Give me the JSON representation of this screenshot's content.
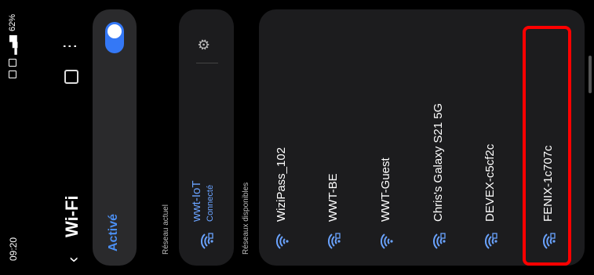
{
  "status": {
    "time": "09:20",
    "battery": "62%"
  },
  "header": {
    "back_icon": "chevron-left-icon",
    "title": "Wi-Fi"
  },
  "toggle": {
    "label": "Activé",
    "on": true,
    "accent": "#3478f6"
  },
  "current": {
    "section_label": "Réseau actuel",
    "network": {
      "ssid": "wwt-IoT",
      "status": "Connecté"
    }
  },
  "available": {
    "section_label": "Réseaux disponibles",
    "networks": [
      {
        "ssid": "WiziPass_102"
      },
      {
        "ssid": "WWT-BE"
      },
      {
        "ssid": "WWT-Guest"
      },
      {
        "ssid": "Chris's Galaxy S21 5G"
      },
      {
        "ssid": "DEVEX-c5cf2c"
      },
      {
        "ssid": "FENIX-1c707c"
      }
    ]
  },
  "highlight_color": "#ff0000"
}
